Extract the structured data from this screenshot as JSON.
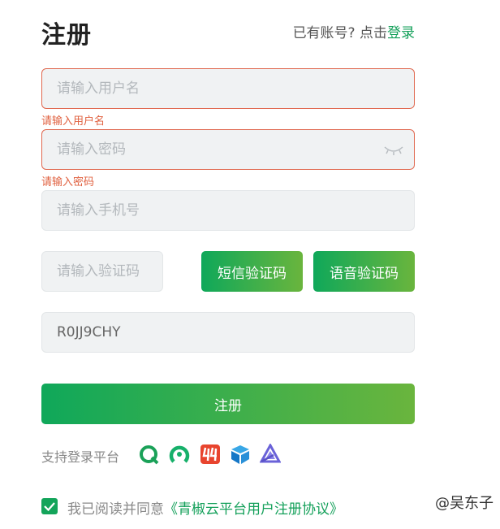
{
  "header": {
    "title": "注册",
    "have_account": "已有账号? 点击",
    "login_link": "登录"
  },
  "form": {
    "username_placeholder": "请输入用户名",
    "username_error": "请输入用户名",
    "password_placeholder": "请输入密码",
    "password_error": "请输入密码",
    "phone_placeholder": "请输入手机号",
    "code_placeholder": "请输入验证码",
    "sms_code_button": "短信验证码",
    "voice_code_button": "语音验证码",
    "captcha_value": "R0JJ9CHY",
    "submit_button": "注册"
  },
  "platforms": {
    "label": "支持登录平台",
    "icons": [
      "qingcloud-icon",
      "green-logo-icon",
      "red-logo-icon",
      "cube-icon",
      "triangle-logo-icon"
    ]
  },
  "agreement": {
    "checked": true,
    "text": "我已阅读并同意",
    "link": "《青椒云平台用户注册协议》"
  },
  "watermark": "@吴东子",
  "colors": {
    "accent": "#14a05a",
    "error": "#e0603f",
    "gradient_start": "#0fa85a",
    "gradient_end": "#6ab53d"
  }
}
